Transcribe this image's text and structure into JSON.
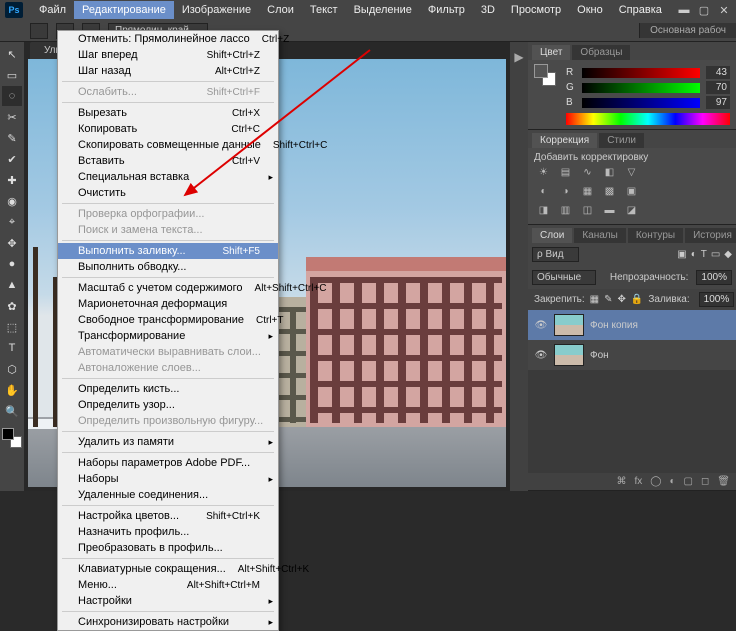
{
  "menubar": {
    "items": [
      "Файл",
      "Редактирование",
      "Изображение",
      "Слои",
      "Текст",
      "Выделение",
      "Фильтр",
      "3D",
      "Просмотр",
      "Окно",
      "Справка"
    ],
    "active_index": 1
  },
  "optionsbar": {
    "dropdown1": "Прямолин. край...",
    "right_label": "Основная рабоч"
  },
  "doc_tab": "Улица",
  "dropdown": {
    "groups": [
      [
        {
          "label": "Отменить: Прямолинейное лассо",
          "short": "Ctrl+Z"
        },
        {
          "label": "Шаг вперед",
          "short": "Shift+Ctrl+Z"
        },
        {
          "label": "Шаг назад",
          "short": "Alt+Ctrl+Z"
        }
      ],
      [
        {
          "label": "Ослабить...",
          "short": "Shift+Ctrl+F",
          "disabled": true
        }
      ],
      [
        {
          "label": "Вырезать",
          "short": "Ctrl+X"
        },
        {
          "label": "Копировать",
          "short": "Ctrl+C"
        },
        {
          "label": "Скопировать совмещенные данные",
          "short": "Shift+Ctrl+C"
        },
        {
          "label": "Вставить",
          "short": "Ctrl+V"
        },
        {
          "label": "Специальная вставка",
          "sub": true
        },
        {
          "label": "Очистить"
        }
      ],
      [
        {
          "label": "Проверка орфографии...",
          "disabled": true
        },
        {
          "label": "Поиск и замена текста...",
          "disabled": true
        }
      ],
      [
        {
          "label": "Выполнить заливку...",
          "short": "Shift+F5",
          "highlight": true
        },
        {
          "label": "Выполнить обводку..."
        }
      ],
      [
        {
          "label": "Масштаб с учетом содержимого",
          "short": "Alt+Shift+Ctrl+C"
        },
        {
          "label": "Марионеточная деформация"
        },
        {
          "label": "Свободное трансформирование",
          "short": "Ctrl+T"
        },
        {
          "label": "Трансформирование",
          "sub": true
        },
        {
          "label": "Автоматически выравнивать слои...",
          "disabled": true
        },
        {
          "label": "Автоналожение слоев...",
          "disabled": true
        }
      ],
      [
        {
          "label": "Определить кисть..."
        },
        {
          "label": "Определить узор..."
        },
        {
          "label": "Определить произвольную фигуру...",
          "disabled": true
        }
      ],
      [
        {
          "label": "Удалить из памяти",
          "sub": true
        }
      ],
      [
        {
          "label": "Наборы параметров Adobe PDF..."
        },
        {
          "label": "Наборы",
          "sub": true
        },
        {
          "label": "Удаленные соединения..."
        }
      ],
      [
        {
          "label": "Настройка цветов...",
          "short": "Shift+Ctrl+K"
        },
        {
          "label": "Назначить профиль..."
        },
        {
          "label": "Преобразовать в профиль..."
        }
      ],
      [
        {
          "label": "Клавиатурные сокращения...",
          "short": "Alt+Shift+Ctrl+K"
        },
        {
          "label": "Меню...",
          "short": "Alt+Shift+Ctrl+M"
        },
        {
          "label": "Настройки",
          "sub": true
        }
      ],
      [
        {
          "label": "Синхронизировать настройки",
          "sub": true
        }
      ]
    ]
  },
  "panels": {
    "color": {
      "tabs": [
        "Цвет",
        "Образцы"
      ],
      "r": 43,
      "g": 70,
      "b": 97
    },
    "adjust": {
      "tabs": [
        "Коррекция",
        "Стили"
      ],
      "label": "Добавить корректировку"
    },
    "layers": {
      "tabs": [
        "Слои",
        "Каналы",
        "Контуры",
        "История"
      ],
      "filter": "ρ Вид",
      "blend": "Обычные",
      "opacity_label": "Непрозрачность:",
      "opacity": "100%",
      "lock_label": "Закрепить:",
      "fill_label": "Заливка:",
      "fill": "100%",
      "items": [
        {
          "name": "Фон копия",
          "active": true
        },
        {
          "name": "Фон",
          "active": false
        }
      ]
    }
  },
  "tools": [
    "↖",
    "▭",
    "◌",
    "✂",
    "✎",
    "✔",
    "✚",
    "◉",
    "⌖",
    "✥",
    "●",
    "▲",
    "✿",
    "⬚",
    "T",
    "⬡",
    "✋",
    "🔍"
  ]
}
